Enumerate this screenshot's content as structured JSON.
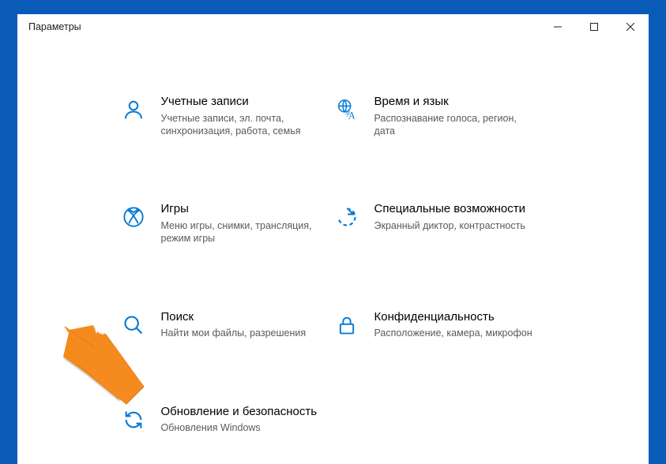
{
  "window": {
    "title": "Параметры"
  },
  "tiles": [
    {
      "title": "Учетные записи",
      "desc": "Учетные записи, эл. почта, синхронизация, работа, семья"
    },
    {
      "title": "Время и язык",
      "desc": "Распознавание голоса, регион, дата"
    },
    {
      "title": "Игры",
      "desc": "Меню игры, снимки, трансляция, режим игры"
    },
    {
      "title": "Специальные возможности",
      "desc": "Экранный диктор, контрастность"
    },
    {
      "title": "Поиск",
      "desc": "Найти мои файлы, разрешения"
    },
    {
      "title": "Конфиденциальность",
      "desc": "Расположение, камера, микрофон"
    },
    {
      "title": "Обновление и безопасность",
      "desc": "Обновления Windows"
    }
  ],
  "colors": {
    "accent": "#0078d4",
    "arrow": "#f58a1f"
  }
}
